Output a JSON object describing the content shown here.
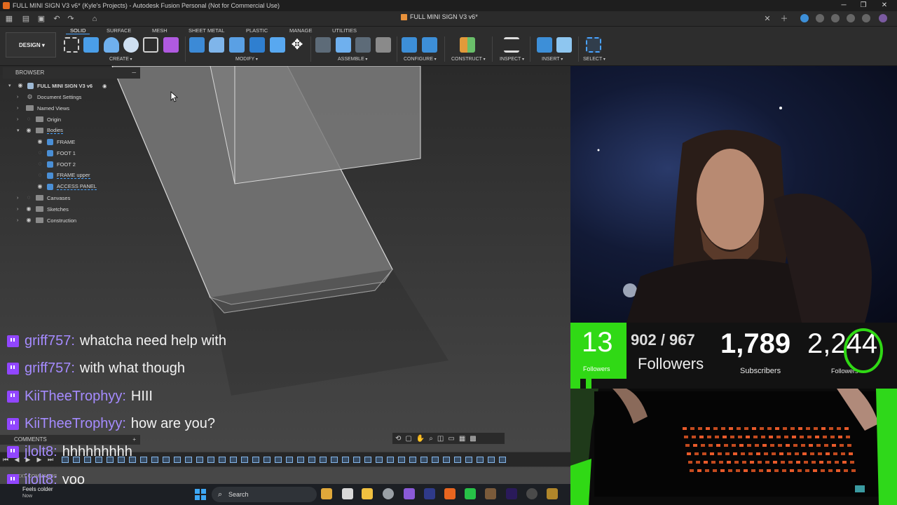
{
  "window": {
    "title": "FULL MINI SIGN V3 v6* (Kyle's Projects) - Autodesk Fusion Personal (Not for Commercial Use)"
  },
  "tab": {
    "document_title": "FULL MINI SIGN V3 v6*"
  },
  "toolbar": {
    "workspace": "DESIGN",
    "tabs": [
      "SOLID",
      "SURFACE",
      "MESH",
      "SHEET METAL",
      "PLASTIC",
      "MANAGE",
      "UTILITIES"
    ],
    "active_tab": "SOLID",
    "groups": [
      "CREATE",
      "MODIFY",
      "ASSEMBLE",
      "CONFIGURE",
      "CONSTRUCT",
      "INSPECT",
      "INSERT",
      "SELECT"
    ]
  },
  "browser": {
    "header": "BROWSER",
    "root": "FULL MINI SIGN V3 v6",
    "items": [
      {
        "label": "Document Settings"
      },
      {
        "label": "Named Views"
      },
      {
        "label": "Origin"
      },
      {
        "label": "Bodies"
      },
      {
        "label": "FRAME"
      },
      {
        "label": "FOOT 1"
      },
      {
        "label": "FOOT 2"
      },
      {
        "label": "FRAME upper"
      },
      {
        "label": "ACCESS PANEL"
      },
      {
        "label": "Canvases"
      },
      {
        "label": "Sketches"
      },
      {
        "label": "Construction"
      }
    ]
  },
  "chat": {
    "messages": [
      {
        "user": "griff757:",
        "text": "whatcha need help with"
      },
      {
        "user": "griff757:",
        "text": "with what though"
      },
      {
        "user": "KiiTheeTrophyy:",
        "text": "HIII"
      },
      {
        "user": "KiiTheeTrophyy:",
        "text": "how are you?"
      },
      {
        "user": "jlolt8:",
        "text": "hhhhhhhhh"
      },
      {
        "user": "jlolt8:",
        "text": "yoo"
      }
    ]
  },
  "panels": {
    "comments": "COMMENTS",
    "text_commands": "TEXT COMMANDS"
  },
  "taskbar": {
    "weather_title": "Feels colder",
    "weather_sub": "Now",
    "search_placeholder": "Search"
  },
  "stats": {
    "followers_today": "13",
    "followers_today_label": "Followers",
    "goal": "902 / 967",
    "goal_label": "Followers",
    "subscribers": "1,789",
    "subscribers_label": "Subscribers",
    "followers_total": "2,244",
    "followers_total_label": "Followers"
  },
  "colors": {
    "twitch": "#9146ff",
    "accent_green": "#30d915",
    "fusion_blue": "#4aa3ff"
  }
}
